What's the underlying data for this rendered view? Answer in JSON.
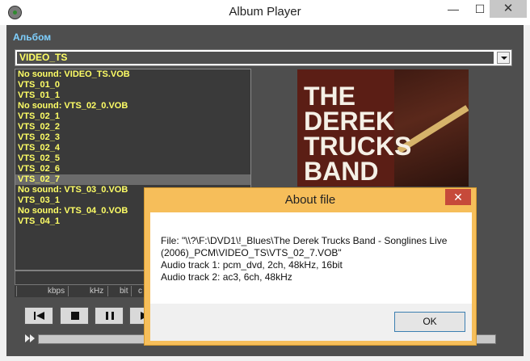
{
  "window": {
    "title": "Album Player",
    "minimize_glyph": "—",
    "maximize_glyph": "☐",
    "close_glyph": "✕"
  },
  "album": {
    "label": "Альбом",
    "selected_folder": "VIDEO_TS"
  },
  "tracks": [
    {
      "label": "No sound: VIDEO_TS.VOB",
      "selected": false
    },
    {
      "label": "VTS_01_0",
      "selected": false
    },
    {
      "label": "VTS_01_1",
      "selected": false
    },
    {
      "label": "No sound: VTS_02_0.VOB",
      "selected": false
    },
    {
      "label": "VTS_02_1",
      "selected": false
    },
    {
      "label": "VTS_02_2",
      "selected": false
    },
    {
      "label": "VTS_02_3",
      "selected": false
    },
    {
      "label": "VTS_02_4",
      "selected": false
    },
    {
      "label": "VTS_02_5",
      "selected": false
    },
    {
      "label": "VTS_02_6",
      "selected": false
    },
    {
      "label": "VTS_02_7",
      "selected": true
    },
    {
      "label": "No sound: VTS_03_0.VOB",
      "selected": false
    },
    {
      "label": "VTS_03_1",
      "selected": false
    },
    {
      "label": "No sound: VTS_04_0.VOB",
      "selected": false
    },
    {
      "label": "VTS_04_1",
      "selected": false
    }
  ],
  "info_bar": {
    "kbps": "kbps",
    "khz": "kHz",
    "bit": "bit",
    "ch": "c"
  },
  "cover": {
    "lines": [
      "THE",
      "DEREK",
      "TRUCKS",
      "BAND"
    ]
  },
  "controls": [
    "previous-icon",
    "stop-icon",
    "pause-icon",
    "play-icon"
  ],
  "colors": {
    "track_text": "#ffff66",
    "album_label": "#7fd0ff",
    "dialog_frame": "#f6be5a",
    "dialog_close": "#c64a3a"
  },
  "dialog": {
    "title": "About file",
    "close_glyph": "✕",
    "lines": [
      "File: \"\\\\?\\F:\\DVD1\\!_Blues\\The Derek Trucks Band - Songlines Live",
      "(2006)_PCM\\VIDEO_TS\\VTS_02_7.VOB\"",
      "Audio track 1: pcm_dvd, 2ch, 48kHz, 16bit",
      "Audio track 2: ac3, 6ch, 48kHz"
    ],
    "ok_label": "OK"
  }
}
